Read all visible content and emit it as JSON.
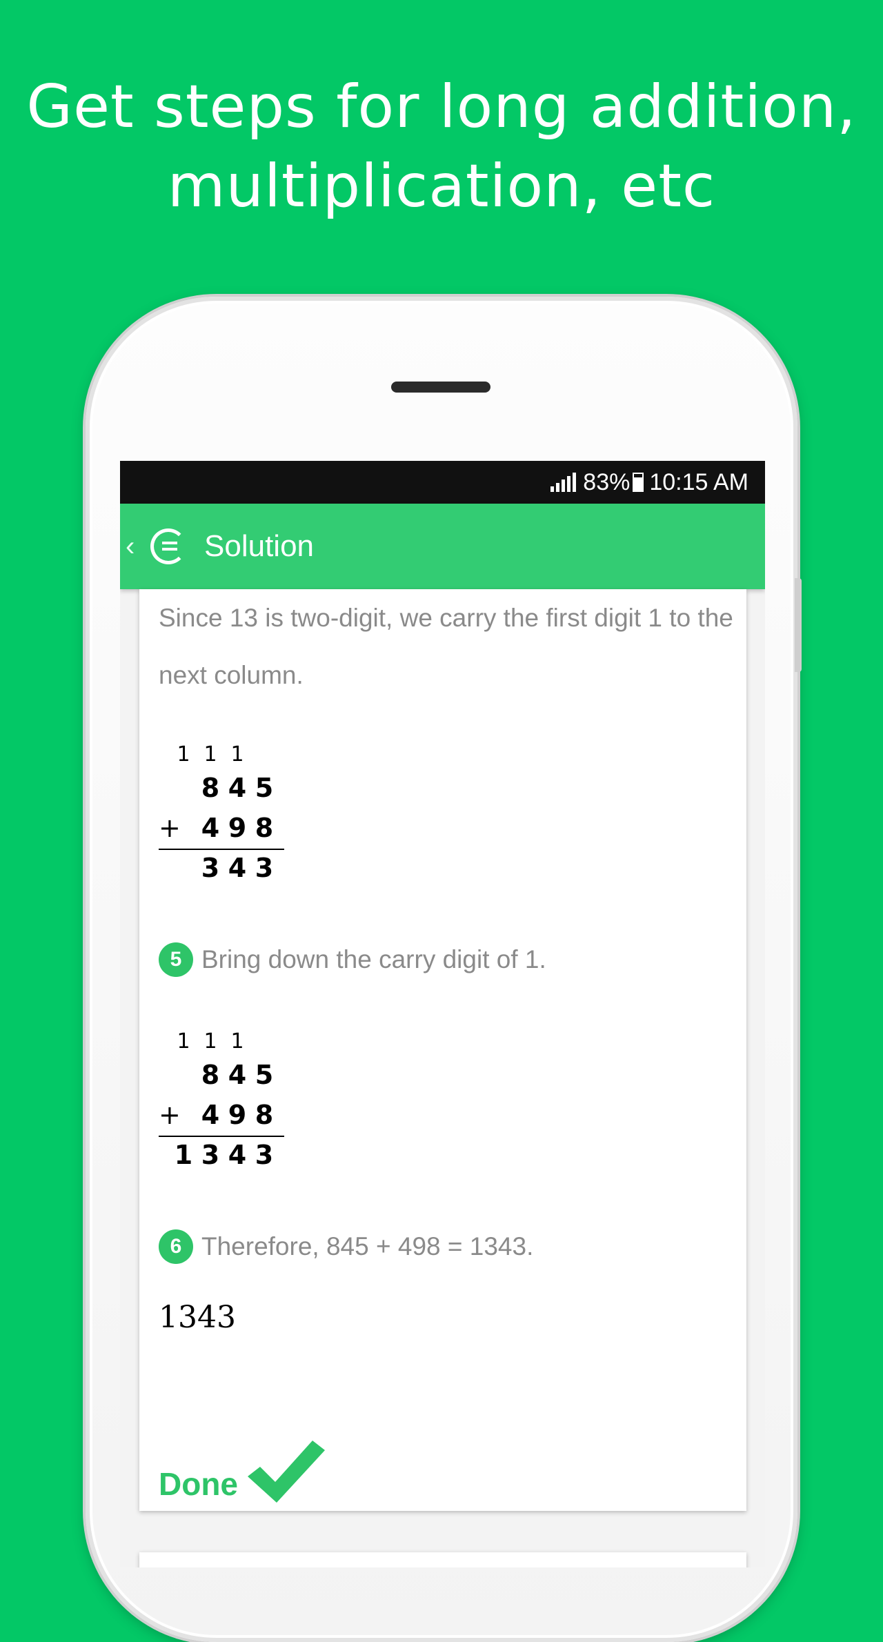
{
  "headline": {
    "line1": "Get steps for long addition,",
    "line2": "multiplication, etc"
  },
  "status_bar": {
    "battery": "83%",
    "time": "10:15 AM"
  },
  "app_bar": {
    "title": "Solution"
  },
  "content": {
    "intro": "Since 13 is two-digit, we carry the first digit 1 to the next column.",
    "calc1": {
      "carry": [
        "1",
        "1",
        "1"
      ],
      "top": [
        "8",
        "4",
        "5"
      ],
      "operator": "+",
      "bottom": [
        "4",
        "9",
        "8"
      ],
      "result": [
        "3",
        "4",
        "3"
      ]
    },
    "step5": {
      "number": "5",
      "text": "Bring down the carry digit of 1."
    },
    "calc2": {
      "carry": [
        "1",
        "1",
        "1"
      ],
      "top": [
        "8",
        "4",
        "5"
      ],
      "operator": "+",
      "bottom": [
        "4",
        "9",
        "8"
      ],
      "result": [
        "1",
        "3",
        "4",
        "3"
      ]
    },
    "step6": {
      "number": "6",
      "text": "Therefore, 845 + 498 = 1343."
    },
    "answer": "1343",
    "done_label": "Done"
  },
  "colors": {
    "background": "#03c866",
    "app_bar": "#33cc73",
    "accent": "#2ec468"
  }
}
